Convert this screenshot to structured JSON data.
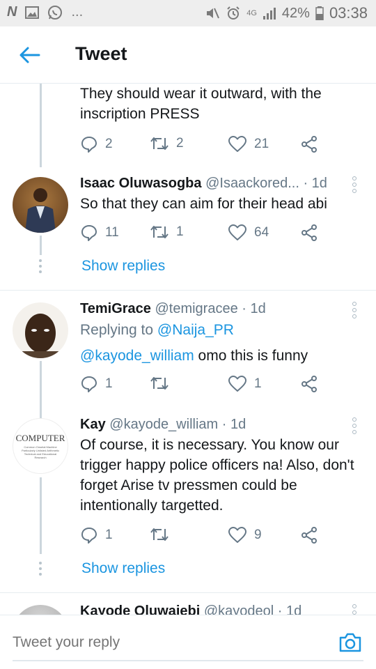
{
  "status_bar": {
    "time": "03:38",
    "battery": "42%",
    "network": "4G",
    "left_dots": "..."
  },
  "header": {
    "title": "Tweet"
  },
  "tweets": [
    {
      "text": "They should wear it outward, with the inscription PRESS",
      "replies": "2",
      "retweets": "2",
      "likes": "21"
    },
    {
      "name": "Isaac Oluwasogba",
      "handle": "@Isaackored...",
      "time": "· 1d",
      "text": "So that they can aim for their head abi",
      "replies": "11",
      "retweets": "1",
      "likes": "64",
      "show_replies": "Show replies"
    },
    {
      "name": "TemiGrace",
      "handle": "@temigracee",
      "time": "· 1d",
      "replying_label": "Replying to ",
      "replying_to": "@Naija_PR",
      "mention": "@kayode_william",
      "text": " omo this is funny",
      "replies": "1",
      "retweets": "",
      "likes": "1"
    },
    {
      "name": "Kay",
      "handle": "@kayode_william",
      "time": "· 1d",
      "text": "Of course, it is necessary. You know our trigger happy police officers na! Also, don't forget Arise tv pressmen could be intentionally targetted.",
      "avatar_text": "COMPUTER",
      "avatar_subtext": "Common Onsetal Machine Particularly Unlisted Arithmetic Technical and Educational Research",
      "replies": "1",
      "retweets": "",
      "likes": "9",
      "show_replies": "Show replies"
    },
    {
      "name": "Kayode Oluwaiebi",
      "handle": "@kayodeol",
      "time": "· 1d"
    }
  ],
  "footer": {
    "placeholder": "Tweet your reply"
  },
  "colors": {
    "accent": "#1b95e0",
    "text": "#14171a",
    "muted": "#657786",
    "divider": "#e6ecf0"
  }
}
